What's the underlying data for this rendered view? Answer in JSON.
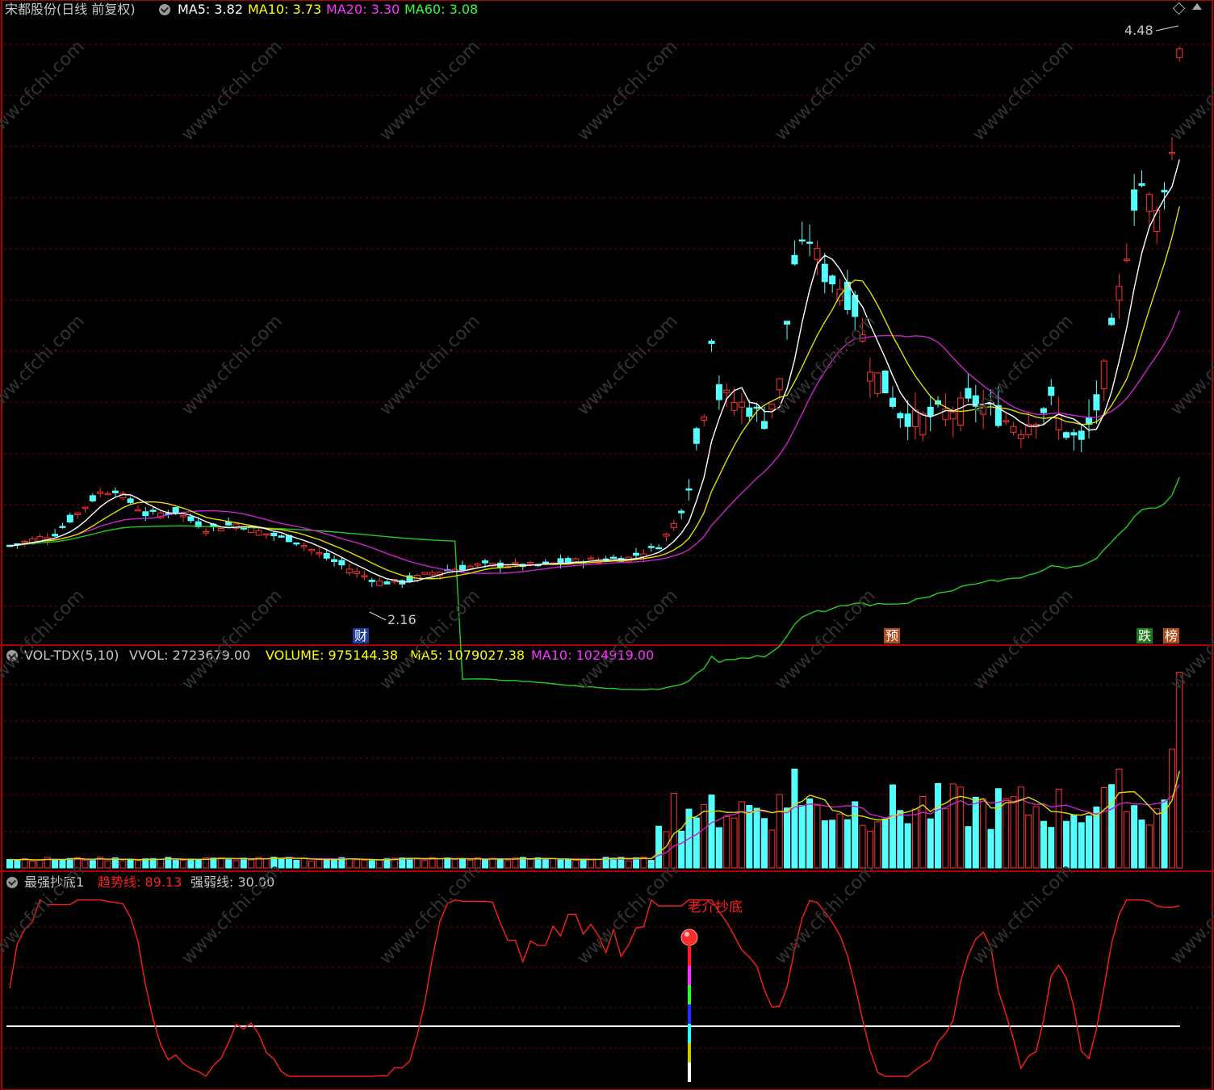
{
  "main": {
    "title": "宋都股份(日线 前复权)",
    "ma": [
      {
        "label": "MA5: 3.82",
        "color": "#ffffff"
      },
      {
        "label": "MA10: 3.73",
        "color": "#ffff00"
      },
      {
        "label": "MA20: 3.30",
        "color": "#ff33ff"
      },
      {
        "label": "MA60: 3.08",
        "color": "#33ff33"
      }
    ],
    "high_label": "4.48",
    "low_label": "2.16",
    "markers": [
      {
        "text": "财",
        "bg": "#1e3f9e",
        "color": "#ffffff"
      },
      {
        "text": "预",
        "bg": "#b24b1a",
        "color": "#ffffff"
      },
      {
        "text": "跌",
        "bg": "#1e7a1e",
        "color": "#ffffff"
      },
      {
        "text": "榜",
        "bg": "#b24b1a",
        "color": "#ffffff"
      }
    ]
  },
  "volume": {
    "name": "VOL-TDX(5,10)",
    "vvol": "VVOL: 2723679.00",
    "volume": "VOLUME: 975144.38",
    "ma5": "MA5: 1079027.38",
    "ma10": "MA10: 1024919.00"
  },
  "indicator": {
    "name": "最强抄底1",
    "trend": "趋势线: 89.13",
    "strength": "强弱线: 30.00",
    "signal": "老介抄底"
  },
  "watermark": "www.cfchi.com",
  "colors": {
    "up": "#ff3232",
    "down": "#54ffff",
    "grid": "#7a0000",
    "frame": "#b00000"
  }
}
